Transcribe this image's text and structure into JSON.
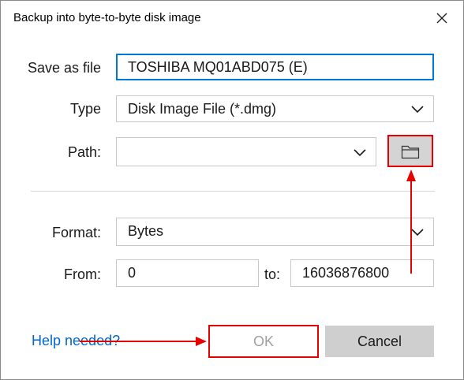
{
  "window": {
    "title": "Backup into byte-to-byte disk image"
  },
  "form": {
    "save_as_label": "Save as file",
    "save_as_value": "TOSHIBA MQ01ABD075 (E)",
    "type_label": "Type",
    "type_value": "Disk Image File (*.dmg)",
    "path_label": "Path:",
    "path_value": "",
    "format_label": "Format:",
    "format_value": "Bytes",
    "from_label": "From:",
    "from_value": "0",
    "to_label": "to:",
    "to_value": "16036876800"
  },
  "footer": {
    "help_label": "Help needed?",
    "ok_label": "OK",
    "cancel_label": "Cancel"
  },
  "icons": {
    "close": "close-icon",
    "chevron": "chevron-down-icon",
    "folder": "folder-icon"
  },
  "colors": {
    "accent": "#0078d7",
    "link": "#0066cc",
    "highlight": "#e60000",
    "disabled_text": "#a0a0a0"
  }
}
